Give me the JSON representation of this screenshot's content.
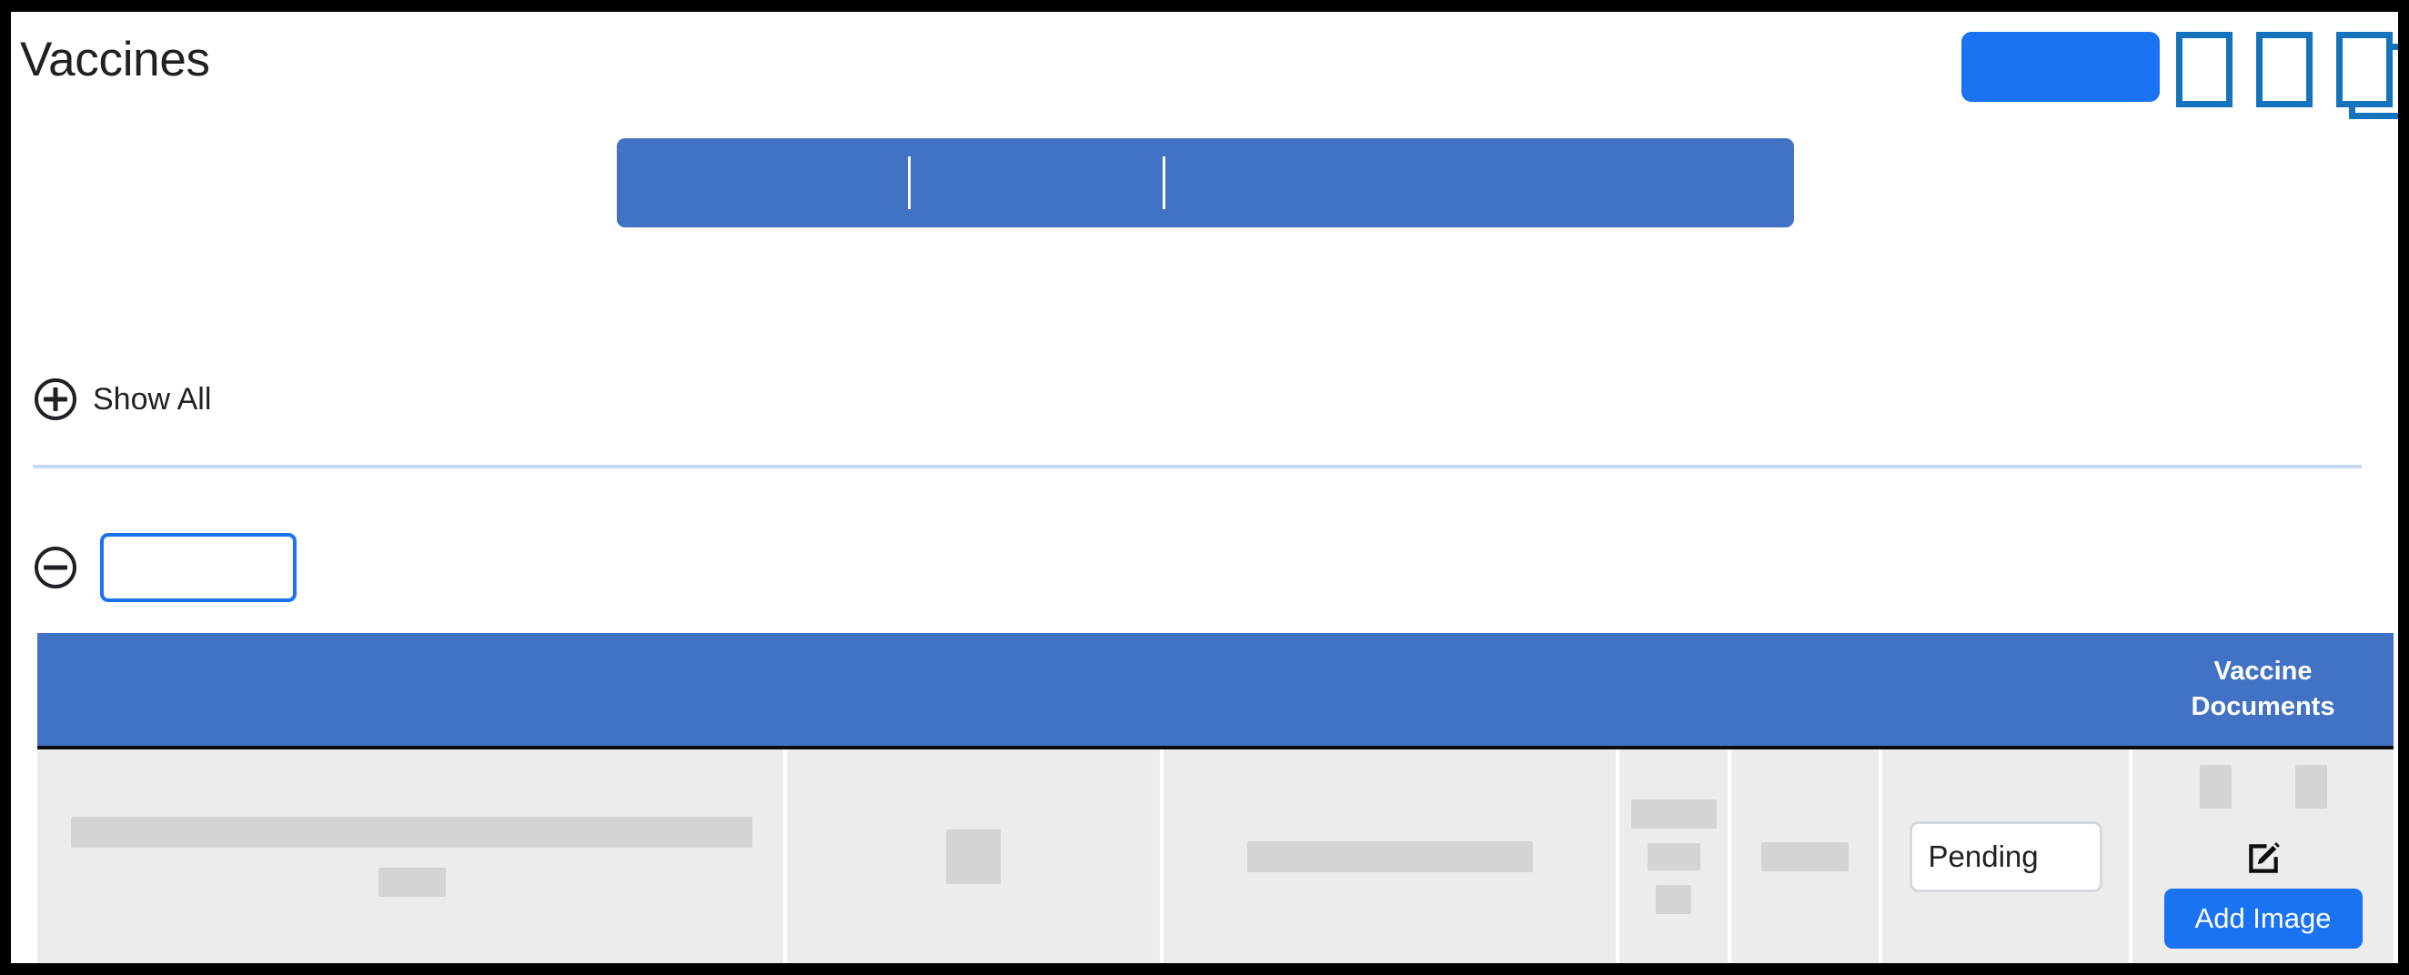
{
  "window": {
    "title": "Vaccines"
  },
  "header": {
    "title": "Vaccines",
    "actions": [
      {
        "name": "primary-action-button",
        "label": "",
        "type": "pill",
        "color": "#1a73f2"
      },
      {
        "name": "document-icon-button-1",
        "label": "",
        "type": "sheet",
        "color": "#1473bd"
      },
      {
        "name": "document-icon-button-2",
        "label": "",
        "type": "sheet",
        "color": "#1473bd"
      },
      {
        "name": "copy-documents-icon-button",
        "label": "",
        "type": "sheet-stacked",
        "color": "#1473bd"
      }
    ]
  },
  "segmented_control": {
    "color": "#4272c4",
    "segments": [
      {
        "label": ""
      },
      {
        "label": ""
      },
      {
        "label": ""
      }
    ]
  },
  "show_all": {
    "label": "Show All",
    "icon": "plus-circle-icon"
  },
  "collapse_section": {
    "icon": "minus-circle-icon",
    "input": {
      "value": "",
      "placeholder": ""
    }
  },
  "table": {
    "header_color": "#4272c4",
    "row_color": "#ececec",
    "columns": [
      {
        "key": "vaccine",
        "label": ""
      },
      {
        "key": "dose",
        "label": ""
      },
      {
        "key": "detail",
        "label": ""
      },
      {
        "key": "dates",
        "label": ""
      },
      {
        "key": "lot",
        "label": ""
      },
      {
        "key": "status",
        "label": ""
      },
      {
        "key": "documents",
        "label": "Vaccine Documents"
      }
    ],
    "rows": [
      {
        "vaccine": "",
        "dose": "",
        "detail": "",
        "dates": "",
        "lot": "",
        "status": "Pending",
        "documents": {
          "thumbnails": 2,
          "edit_icon": "edit-square-icon",
          "add_image_label": "Add Image"
        }
      }
    ]
  },
  "colors": {
    "accent_blue": "#1a73f2",
    "header_blue": "#4272c4",
    "icon_blue": "#1473bd",
    "divider_blue": "#c5d8f3",
    "redaction_gray": "#d4d4d4",
    "row_gray": "#ececec"
  }
}
